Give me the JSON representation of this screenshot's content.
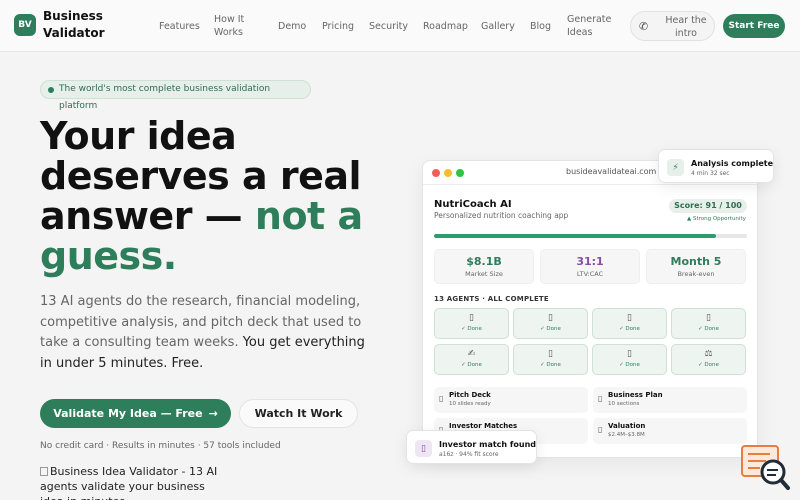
{
  "brand": {
    "badge": "BV",
    "name": "Business Validator"
  },
  "nav": {
    "links": [
      "Features",
      "How It Works",
      "Demo",
      "Pricing",
      "Security",
      "Roadmap",
      "Gallery",
      "Blog",
      "Generate Ideas"
    ],
    "hear_intro": "Hear the intro",
    "start_free": "Start Free"
  },
  "hero": {
    "pill": "The world's most complete business validation platform",
    "headline_part1": "Your idea deserves a real answer — ",
    "headline_accent": "not a guess.",
    "sub_part1": "13 AI agents do the research, financial modeling, competitive analysis, and pitch deck that used to take a consulting team weeks. ",
    "sub_strong": "You get everything in under 5 minutes. Free.",
    "cta_primary": "Validate My Idea — Free",
    "cta_arrow": "→",
    "cta_secondary": "Watch It Work",
    "fine_print": "No credit card · Results in minutes · 57 tools included",
    "image_alt": "Business Idea Validator - 13 AI agents validate your business idea in minutes"
  },
  "mock": {
    "url": "busideavalidateai.com",
    "app_name": "NutriCoach AI",
    "app_subtitle": "Personalized nutrition coaching app",
    "score": "Score: 91 / 100",
    "score_label": "▲ Strong Opportunity",
    "progress": 0.9,
    "metrics": [
      {
        "value": "$8.1B",
        "label": "Market Size",
        "color": "#2e7d5b"
      },
      {
        "value": "31:1",
        "label": "LTV:CAC",
        "color": "#8a4aa8"
      },
      {
        "value": "Month 5",
        "label": "Break-even",
        "color": "#2e7d5b"
      }
    ],
    "agents_label": "13 AGENTS · ALL COMPLETE",
    "agents": [
      {
        "icon": "▯",
        "status": "✓ Done"
      },
      {
        "icon": "▯",
        "status": "✓ Done"
      },
      {
        "icon": "▯",
        "status": "✓ Done"
      },
      {
        "icon": "▯",
        "status": "✓ Done"
      },
      {
        "icon": "✍",
        "status": "✓ Done"
      },
      {
        "icon": "▯",
        "status": "✓ Done"
      },
      {
        "icon": "▯",
        "status": "✓ Done"
      },
      {
        "icon": "⚖",
        "status": "✓ Done"
      }
    ],
    "deliverables": [
      {
        "title": "Pitch Deck",
        "sub": "10 slides ready"
      },
      {
        "title": "Business Plan",
        "sub": "10 sections"
      },
      {
        "title": "Investor Matches",
        "sub": ""
      },
      {
        "title": "Valuation",
        "sub": "$2.4M–$3.8M"
      }
    ]
  },
  "floats": {
    "analysis": {
      "icon": "⚡",
      "title": "Analysis complete",
      "sub": "4 min 32 sec"
    },
    "investor": {
      "icon": "▯",
      "title": "Investor match found",
      "sub": "a16z · 94% fit score"
    }
  }
}
